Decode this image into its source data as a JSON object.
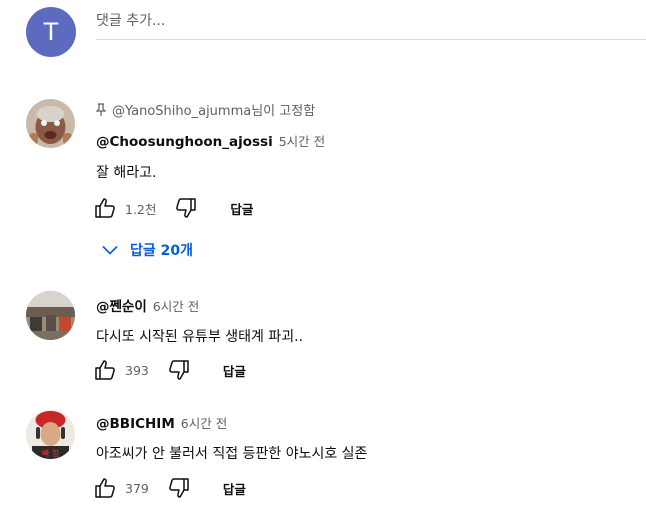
{
  "composer": {
    "avatar_letter": "T",
    "placeholder": "댓글 추가..."
  },
  "comments": [
    {
      "pinned_by": "@YanoShiho_ajumma",
      "pinned_suffix": "님이 고정함",
      "author": "@Choosunghoon_ajossi",
      "time": "5시간 전",
      "text": "잘 해라고.",
      "likes": "1.2천",
      "reply_label": "답글",
      "replies_label": "답글 20개"
    },
    {
      "author": "@쩬순이",
      "time": "6시간 전",
      "text": "다시또 시작된 유튜부 생태계 파괴..",
      "likes": "393",
      "reply_label": "답글"
    },
    {
      "author": "@BBICHIM",
      "time": "6시간 전",
      "text": "아조씨가 안 불러서 직접 등판한 야노시호 실존",
      "likes": "379",
      "reply_label": "답글"
    }
  ],
  "colors": {
    "accent_blue": "#065fd4",
    "avatar_bg": "#5c6bc0",
    "secondary_text": "#606060"
  },
  "icons": [
    "pin-icon",
    "like-icon",
    "dislike-icon",
    "chevron-down-icon"
  ]
}
